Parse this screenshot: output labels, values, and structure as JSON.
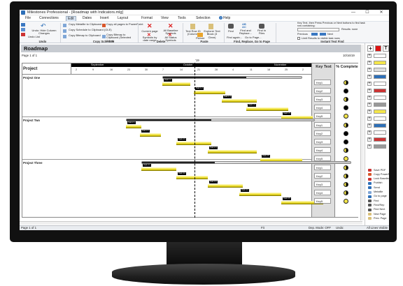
{
  "window": {
    "title": "Milestones Professional - [Roadmap with Indicators.mlg]",
    "minimize": "—",
    "maximize": "☐",
    "close": "✕"
  },
  "menu": [
    "File",
    "Connections",
    "Edit",
    "Dates",
    "Insert",
    "Layout",
    "Format",
    "View",
    "Tools",
    "Selection",
    "Help"
  ],
  "menu_active_index": 2,
  "ribbon": {
    "undo_hide": "Undo: Hide Column Changes",
    "undo_list": "Undo List",
    "copy_metafile": "Copy Metafile to Clipboard",
    "copy_all_pages": "Copy all pages to PowerPoint",
    "copy_schedule_clip": "Copy Schedule to Clipboard (OLE)",
    "copy_bitmap": "Copy Bitmap to Clipboard",
    "copy_bitmap_sel": "Copy Bitmap to Clipboard (Selected Rows)",
    "current_page": "Current page",
    "all_baseline": "All Baseline Symbols",
    "symbols_by_date": "Symbols by date range",
    "all_status": "All Status Symbols",
    "text_row_id": "Text Row ID (Column)",
    "explorer_text": "Explorer Text Block (3 Clear)",
    "picture": "Picture",
    "find": "Find",
    "find_replace": "Find and Replace...",
    "find_in_files": "Find in Files",
    "find_again": "Find again...",
    "go_to_page": "Go to Page...",
    "grp_undo": "Undo",
    "grp_copy": "Copy Schedule",
    "grp_delete": "Delete",
    "grp_paste": "Paste",
    "grp_find": "Find, Replace, Go to Page",
    "grp_instant": "Instant Text Find",
    "instant_hint": "Key Text, then Press Previous or Next buttons to find task row containing:",
    "results_none": "Results: none",
    "previous": "Previous",
    "next": "Next",
    "limit_results": "Limit Results to visible task rows"
  },
  "document": {
    "title": "Roadmap",
    "page_label": "Page 1 of 1",
    "date": "10/16/19",
    "year_tag": "'19"
  },
  "gantt": {
    "project_header": "Project",
    "key_header": "Key Text",
    "pct_header": "% Complete",
    "months": [
      "September",
      "October",
      "November"
    ],
    "days": [
      "2",
      "9",
      "16",
      "23",
      "30",
      "7",
      "14",
      "21",
      "28",
      "4",
      "11",
      "18",
      "25",
      "2"
    ],
    "projects": [
      {
        "name": "Project One",
        "keys": [
          "Key1",
          "Key2",
          "Key3",
          "Key4",
          "Key5"
        ],
        "pct": [
          50,
          100,
          50,
          100,
          0
        ]
      },
      {
        "name": "Project Two",
        "keys": [
          "Key1",
          "Key2",
          "Key3",
          "Key4",
          "Key5"
        ],
        "pct": [
          50,
          100,
          100,
          50,
          0
        ]
      },
      {
        "name": "Project Three",
        "keys": [
          "Key1",
          "Key2",
          "Key3",
          "Key4",
          "Key5"
        ],
        "pct": [
          50,
          50,
          50,
          50,
          0
        ]
      }
    ],
    "task_labels": [
      "Task 1.1",
      "Task 1.2",
      "Task 1.3",
      "Task 1.4",
      "Task 1.5",
      "Task 2.1",
      "Task 2.2",
      "Task 2.3",
      "Task 2.4",
      "Task 2.5",
      "Task 3.1",
      "Task 3.2",
      "Task 3.3",
      "Task 3.4",
      "Task 3.5"
    ]
  },
  "toolbox": {
    "commands": [
      "Save PDF",
      "Copy PowerPoint",
      "Lock Baseline",
      "Publish",
      "Send",
      "Metafile",
      "Go to page",
      "Find",
      "Find/Rep",
      "Find Next",
      "New Page",
      "Prev. Page"
    ]
  },
  "status": {
    "page": "Page 1 of 1",
    "fit": "Fit",
    "dep_mode": "Dep. Mode: OFF",
    "undo": "Undo:",
    "all_lines": "All Lines Visible"
  }
}
